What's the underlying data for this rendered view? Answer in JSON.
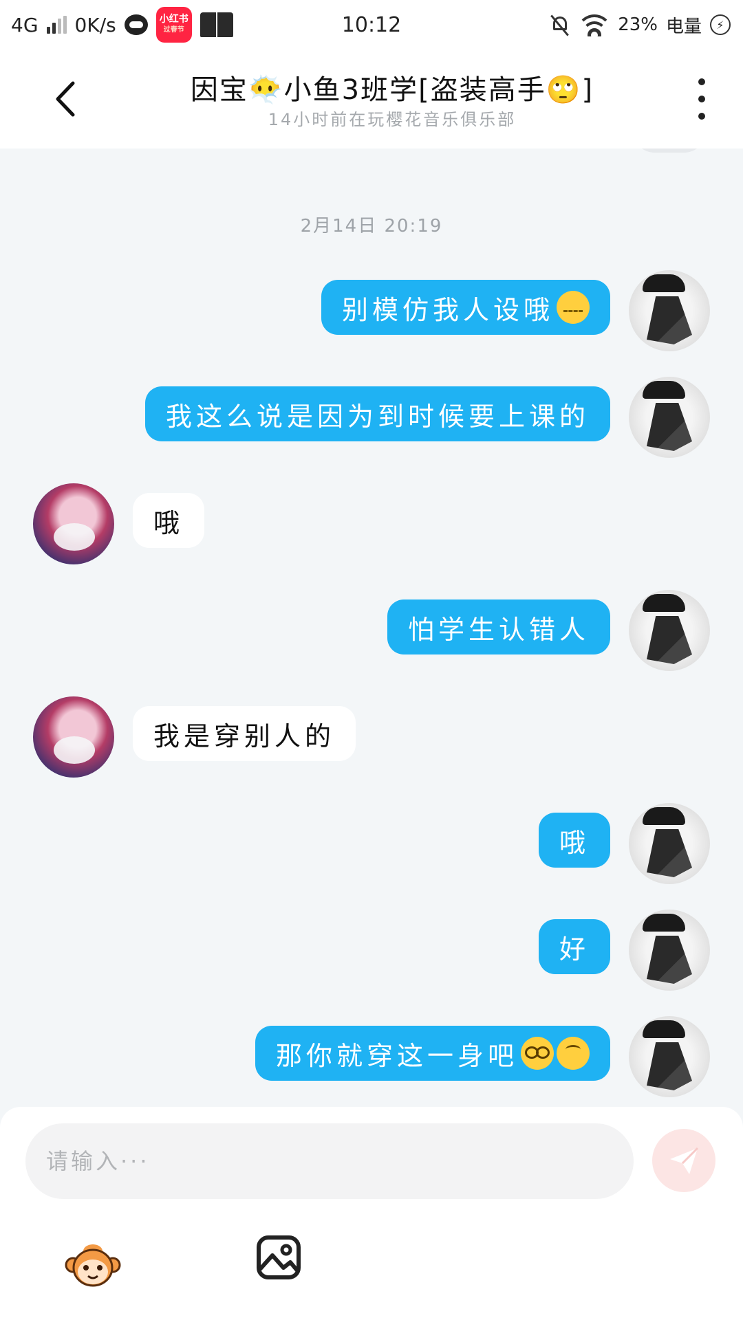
{
  "status_bar": {
    "network": "4G",
    "speed": "0K/s",
    "app_badge_top": "小红书",
    "app_badge_bottom": "过春节",
    "time": "10:12",
    "battery": "23%",
    "battery_label": "电量"
  },
  "header": {
    "title": "因宝😶‍🌫️小鱼3班学[盗装高手🙄]",
    "subtitle": "14小时前在玩樱花音乐俱乐部"
  },
  "chat": {
    "timestamp": "2月14日 20:19",
    "messages": [
      {
        "direction": "sent",
        "text": "别模仿我人设哦",
        "emoji": "zipper-mouth-face"
      },
      {
        "direction": "sent",
        "text": "我这么说是因为到时候要上课的"
      },
      {
        "direction": "received",
        "text": "哦"
      },
      {
        "direction": "sent",
        "text": "怕学生认错人"
      },
      {
        "direction": "received",
        "text": "我是穿别人的"
      },
      {
        "direction": "sent",
        "text": "哦"
      },
      {
        "direction": "sent",
        "text": "好"
      },
      {
        "direction": "sent",
        "text": "那你就穿这一身吧",
        "emoji": "nerd-face upside-down-face"
      }
    ]
  },
  "composer": {
    "placeholder": "请输入···",
    "accent_color": "#1fb2f3",
    "send_color": "#fce5e4"
  }
}
